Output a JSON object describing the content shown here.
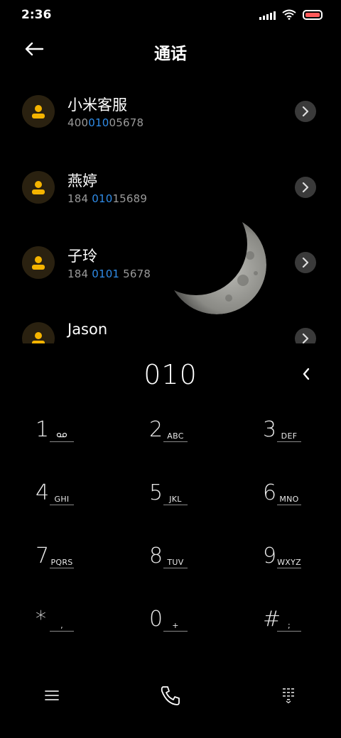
{
  "status": {
    "time": "2:36",
    "battery_color": "#ff5a5a"
  },
  "header": {
    "back_icon": "arrow-left-icon",
    "title": "通话"
  },
  "contacts": [
    {
      "name": "小米客服",
      "number_parts": [
        "400",
        "010",
        "05678"
      ]
    },
    {
      "name": "燕婷",
      "number_parts": [
        "184 ",
        "010",
        "15689"
      ]
    },
    {
      "name": "子玲",
      "number_parts": [
        "184 ",
        "0101",
        " 5678"
      ]
    },
    {
      "name": "Jason",
      "number_parts": [
        "",
        "",
        ""
      ]
    }
  ],
  "colors": {
    "highlight": "#2f8ce8",
    "avatar_icon": "#f5b400"
  },
  "dialer": {
    "input": "010",
    "backspace_icon": "chevron-left-icon",
    "keys": [
      {
        "digit": "1",
        "letters": "",
        "icon": "voicemail-icon"
      },
      {
        "digit": "2",
        "letters": "ABC"
      },
      {
        "digit": "3",
        "letters": "DEF"
      },
      {
        "digit": "4",
        "letters": "GHI"
      },
      {
        "digit": "5",
        "letters": "JKL"
      },
      {
        "digit": "6",
        "letters": "MNO"
      },
      {
        "digit": "7",
        "letters": "PQRS"
      },
      {
        "digit": "8",
        "letters": "TUV"
      },
      {
        "digit": "9",
        "letters": "WXYZ"
      },
      {
        "digit": "*",
        "letters": ","
      },
      {
        "digit": "0",
        "letters": "+"
      },
      {
        "digit": "#",
        "letters": ";"
      }
    ]
  },
  "bottom_bar": {
    "menu_icon": "menu-icon",
    "call_icon": "phone-icon",
    "keypad_icon": "dialpad-icon"
  }
}
